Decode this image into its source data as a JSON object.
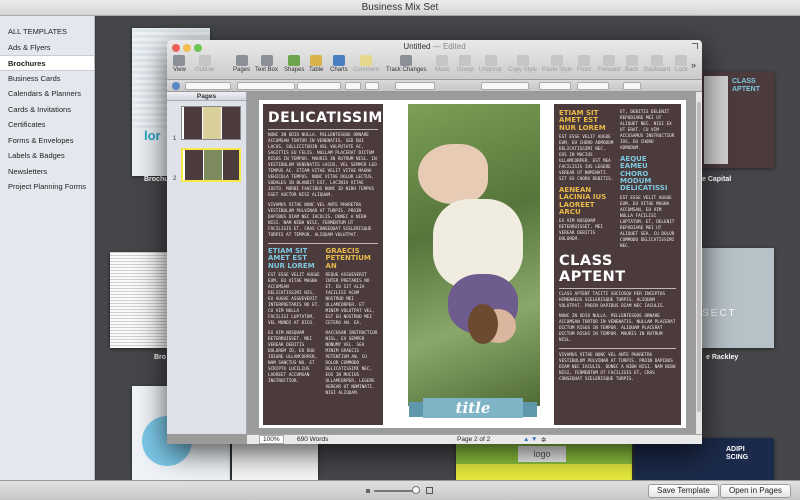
{
  "app": {
    "window_title": "Business Mix Set"
  },
  "sidebar": {
    "items": [
      {
        "label": "ALL TEMPLATES"
      },
      {
        "label": "Ads & Flyers"
      },
      {
        "label": "Brochures"
      },
      {
        "label": "Business Cards"
      },
      {
        "label": "Calendars & Planners"
      },
      {
        "label": "Cards & Invitations"
      },
      {
        "label": "Certificates"
      },
      {
        "label": "Forms & Envelopes"
      },
      {
        "label": "Labels & Badges"
      },
      {
        "label": "Newsletters"
      },
      {
        "label": "Project Planning Forms"
      }
    ],
    "selected": "Brochures"
  },
  "gallery": {
    "captions": [
      "Brochu",
      "e Capital",
      "Bro",
      "e Rackley"
    ],
    "thumb_texts": [
      "lor",
      "CLASS APTENT",
      "SECT",
      "logo",
      "ADIPI",
      "SCING"
    ]
  },
  "bottom": {
    "save_template": "Save Template",
    "open_in_pages": "Open in Pages"
  },
  "pages_window": {
    "title": "Untitled",
    "status_word": "Edited",
    "separator": "—",
    "toolbar": [
      {
        "label": "View",
        "enabled": true
      },
      {
        "label": "Outline",
        "enabled": false
      },
      {
        "label": "Pages",
        "enabled": true
      },
      {
        "label": "Text Box",
        "enabled": true
      },
      {
        "label": "Shapes",
        "enabled": true
      },
      {
        "label": "Table",
        "enabled": true
      },
      {
        "label": "Charts",
        "enabled": true
      },
      {
        "label": "Comment",
        "enabled": false
      },
      {
        "label": "Track Changes",
        "enabled": true
      },
      {
        "label": "Mask",
        "enabled": false
      },
      {
        "label": "Group",
        "enabled": false
      },
      {
        "label": "Ungroup",
        "enabled": false
      },
      {
        "label": "Copy Style",
        "enabled": false
      },
      {
        "label": "Paste Style",
        "enabled": false
      },
      {
        "label": "Front",
        "enabled": false
      },
      {
        "label": "Forward",
        "enabled": false
      },
      {
        "label": "Back",
        "enabled": false
      },
      {
        "label": "Backward",
        "enabled": false
      },
      {
        "label": "Lock",
        "enabled": false
      }
    ],
    "overflow": "»",
    "pages_panel_title": "Pages",
    "page_numbers": [
      "1",
      "2"
    ],
    "status": {
      "zoom": "100%",
      "words": "690 Words",
      "page": "Page 2 of 2"
    }
  },
  "document": {
    "left_title": "DELICATISSIMI",
    "left_p1": "Nunc in odio nulla. Pellentesque ornare accumsan tortor in venenatis. Sed dui lacus, sollicitudin vel vulputate ac, sagittis eu felis. Nullam placerat dictum risus in tempor. Mauris in rutrum nisl. In vestibulum venenatis lacus, vel semper leo tempus ac. Etiam vitae velit vitae magna vehicula tempus. Nunc vitae dolor lectus, sodales in blandit est, lacinia vitae justo. Morbi faucibus nunc id nibh tempus eget auctor nisi aliquam.",
    "left_p2": "Vivamus vitae nunc vel ante pharetra vestibulum pulvinar at turpis. Proin dapibus diam nec iaculis. Donec a nibh nisi. Nam nibh nisi, fermentum ut facilisis et, cras consequat scelerisque turpis at tempor. Aliquam volutpat.",
    "col_a_title": "ETIAM SIT AMET EST NUR LOREM",
    "col_a_p1": "Est esse velit augue eum, eu vitae magna accumsan delicatissimi nis, eu augue assueverit interpretaris no et. Cu vim nulla facilisi luptatum, vel mundi at dico.",
    "col_a_p2": "Ex vim nusquam deterruisset, mei verear debitis dolorem id, eu duo iriure ullamcorper, nam sanctus no. Et scripta lucilius laoreet accumsan instructior.",
    "col_b_title": "GRAECIS PETENTIUM AN",
    "col_b_p1": "Reque assueverit inter pretaris no et. Eu sit alia facilisi acum nostrud mei ullamcorper. Et minim volutpat vel, est eu nostrud mei cetero an. Ea.",
    "col_b_p2": "Raccusan instructior nisl, ex semper nonumy vel. Sea minim graecis petentium an. Cu dolor commodo delicatissimi nec, eos in mucius ullamcorper, legere verear ut nominati. Nisi aliquam.",
    "right_title1": "ETIAM SIT AMET EST NUR LOREM",
    "right_p1": "Est esse velit augue eum, eu choro admodum delicatissimi nec, eos in mucius ullamcorper. Est mea facilisis ius legere verear ut nominati. Sit ex choro debitis.",
    "right_title2": "AENEAN LACINIA IUS LAOREET ARCU",
    "right_p2": "Ex vim nusquam deterruisset, mei verear debitis dolorem.",
    "right_col2_p1": "Et, debitis delenit repudiare mei ut aliquet nec. Nisi ex ut erat. Cu vim accusamus instructior ius, eu choro admodum.",
    "right_title3": "AEQUE EAMEU CHORO MODUM DELICATISSI",
    "right_col2_p2": "Est esse velit augue eum, eu vitae magna accumsan, eu vim nulla facilisi luptatum. Et, delenit repudiare mei ut aliquet sea. Cu dolor commodo delicatissimi nec.",
    "right_big_title": "CLASS APTENT",
    "right_p3": "Class aptent taciti sociosqu per inceptos himenaeos scelerisque turpis. Aliquam volutpat. Proin dapibus diam nec iaculis.",
    "right_p4": "Nunc in odio nulla. Pellentesque ornare accumsan tortor in venenatis. Nullam placerat dictum risus in tempor. Aliquam placerat dictum risus in tempor. Mauris in rutrum nisl.",
    "right_p5": "Vivamus vitae nunc vel ante pharetra vestibulum pulvinar at turpis. Proin dapibus diam nec iaculis. Donec a nibh nisi. Nam nibh nisi, fermentum ut facilisis et, cras consequat scelerisque turpis.",
    "ribbon": "title"
  }
}
